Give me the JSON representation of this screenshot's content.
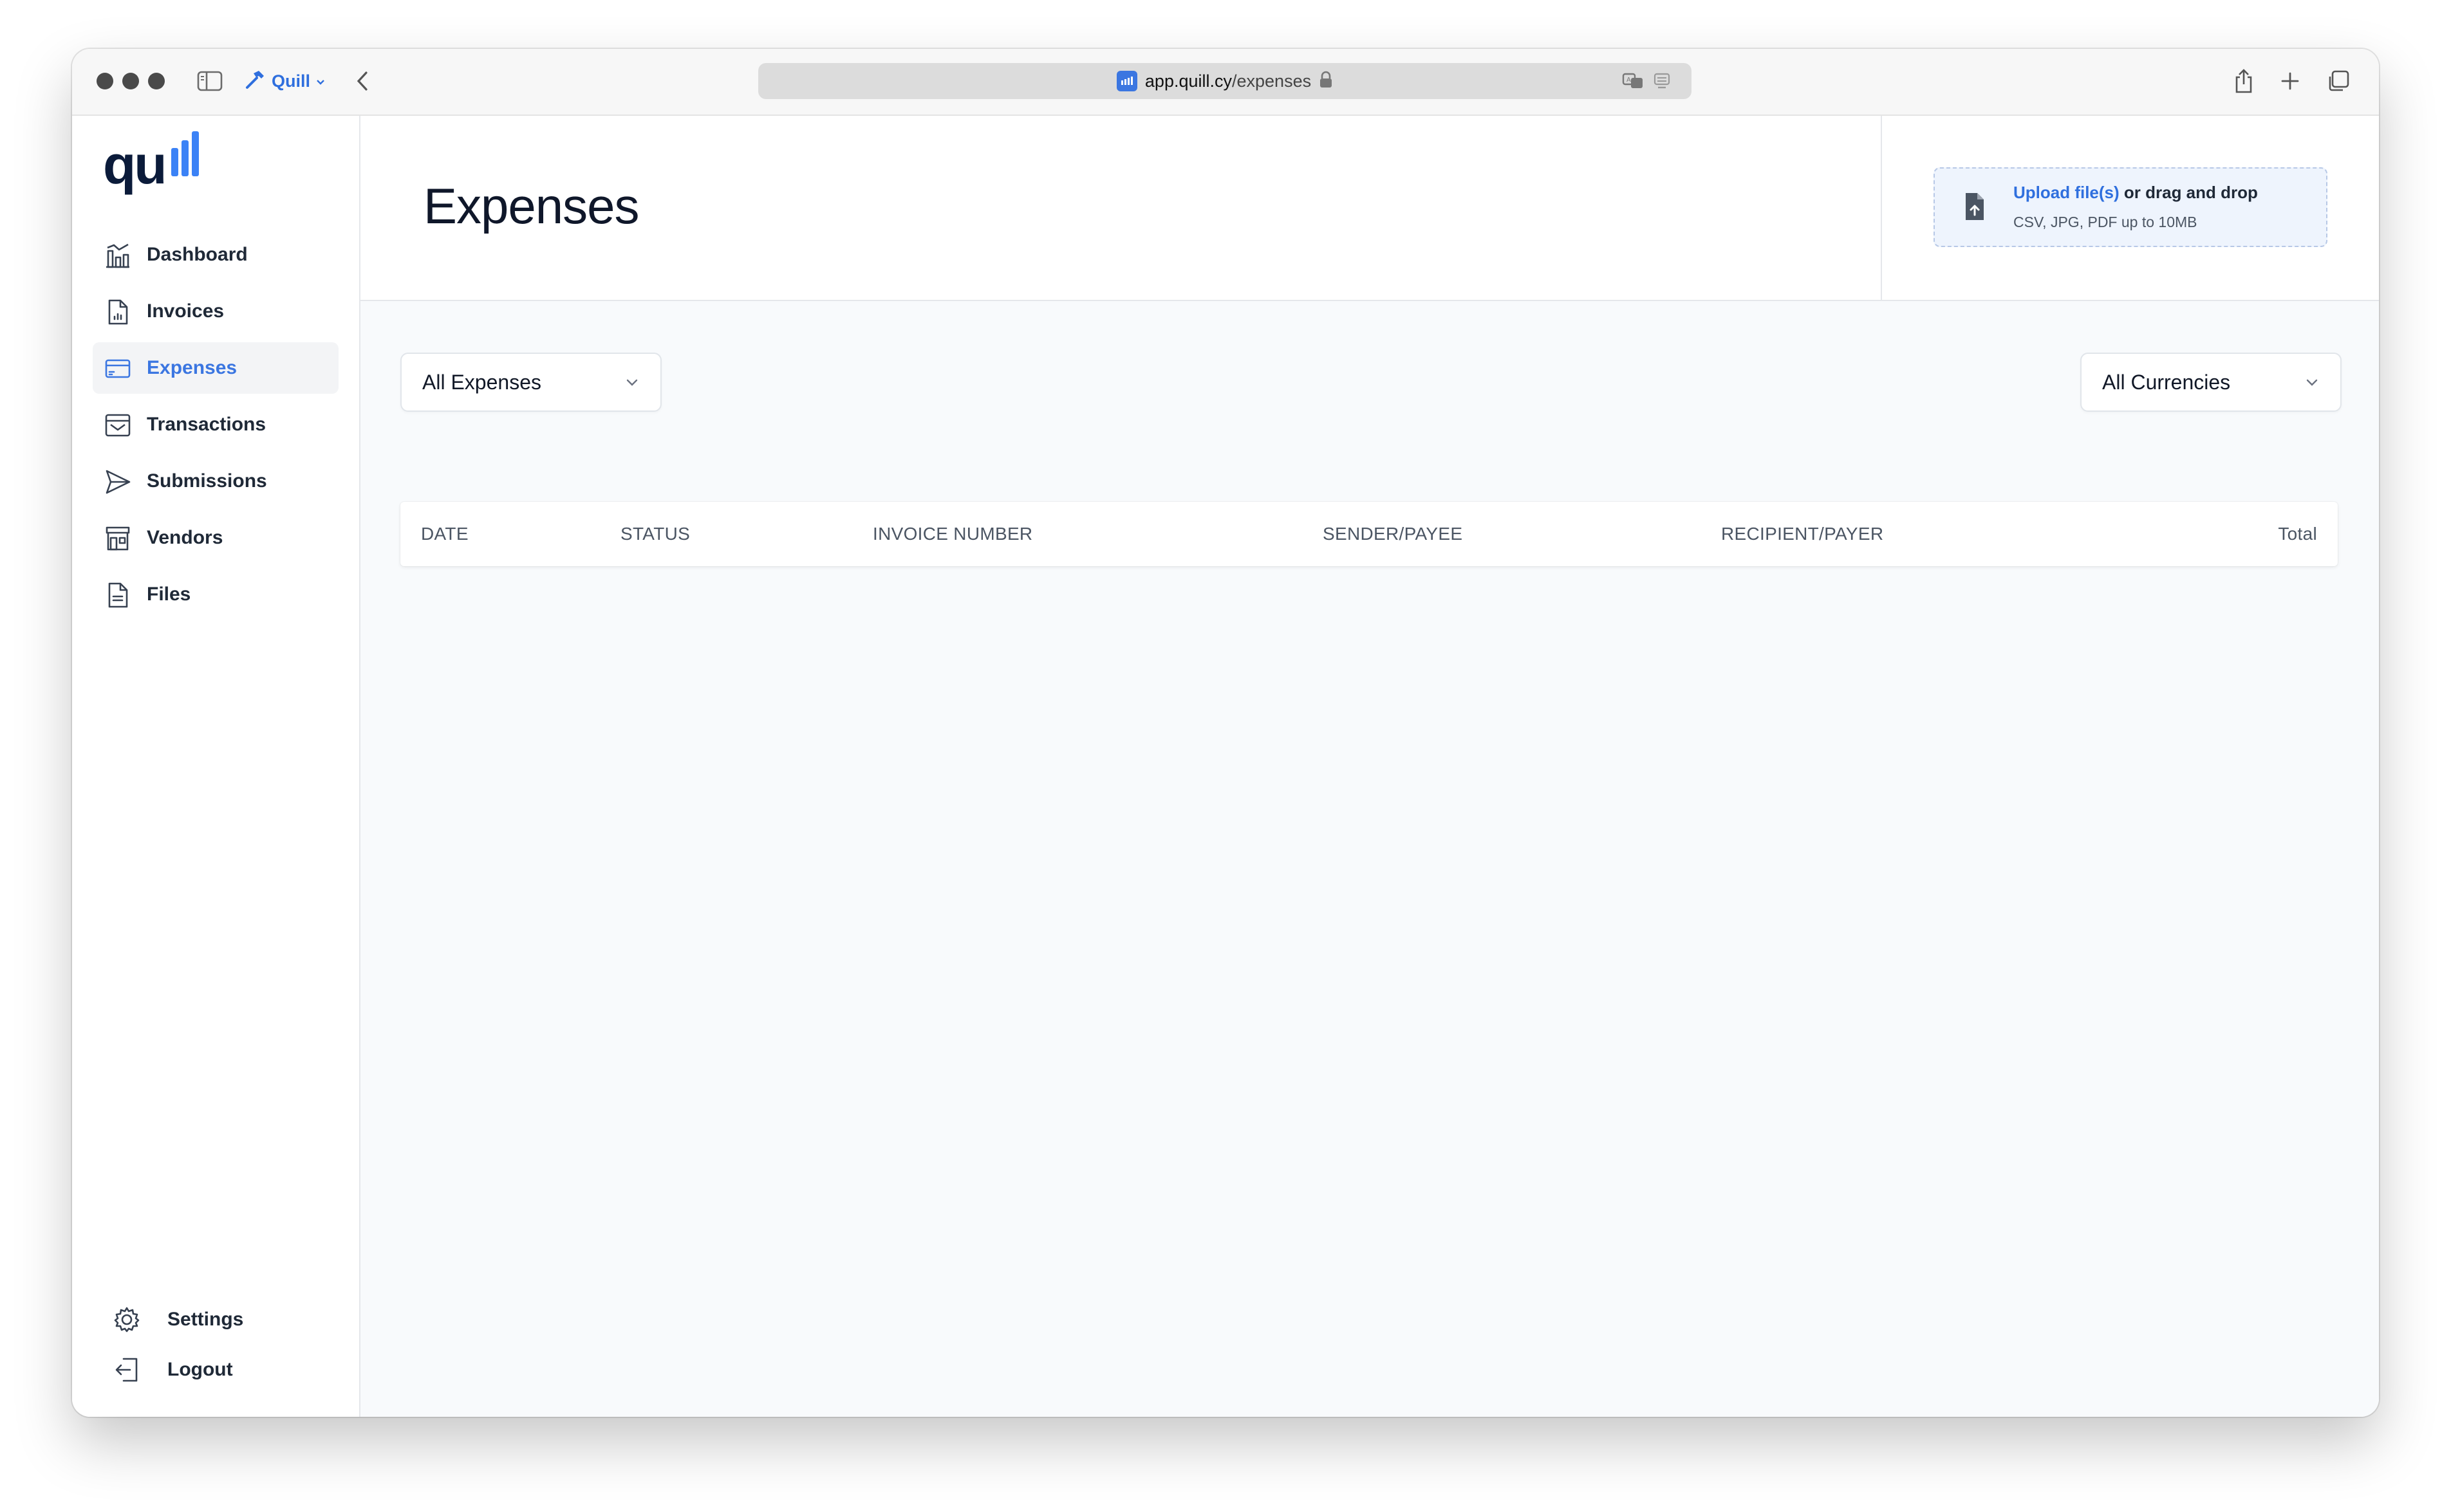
{
  "browser": {
    "profile_name": "Quill",
    "url_domain": "app.quill.cy",
    "url_path": "/expenses"
  },
  "sidebar": {
    "logo_text": "qu",
    "items": [
      {
        "label": "Dashboard",
        "icon": "chart-icon"
      },
      {
        "label": "Invoices",
        "icon": "document-chart-icon"
      },
      {
        "label": "Expenses",
        "icon": "credit-card-icon",
        "active": true
      },
      {
        "label": "Transactions",
        "icon": "inbox-icon"
      },
      {
        "label": "Submissions",
        "icon": "paper-plane-icon"
      },
      {
        "label": "Vendors",
        "icon": "storefront-icon"
      },
      {
        "label": "Files",
        "icon": "document-icon"
      }
    ],
    "bottom": {
      "settings": "Settings",
      "logout": "Logout"
    }
  },
  "header": {
    "title": "Expenses",
    "upload": {
      "link": "Upload file(s)",
      "rest": " or drag and drop",
      "hint": "CSV, JPG, PDF up to 10MB"
    }
  },
  "filters": {
    "type": "All Expenses",
    "currency": "All Currencies"
  },
  "table": {
    "columns": [
      "DATE",
      "STATUS",
      "INVOICE NUMBER",
      "SENDER/PAYEE",
      "RECIPIENT/PAYER",
      "Total"
    ]
  },
  "colors": {
    "accent": "#3b76e1",
    "active_bg": "#f3f4f6",
    "content_bg": "#f8fafc"
  }
}
